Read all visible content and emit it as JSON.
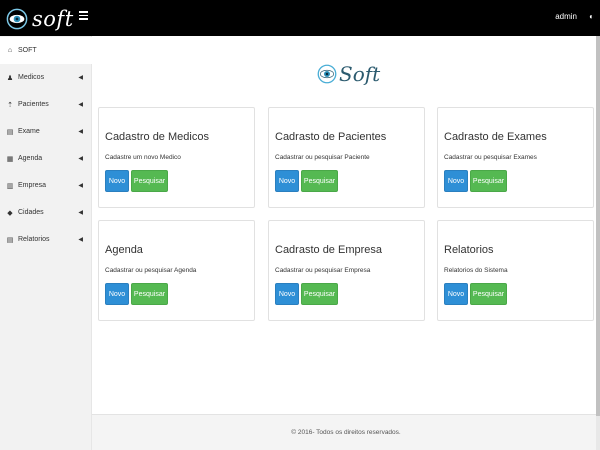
{
  "app": {
    "brand": "soft",
    "logo": "Soft"
  },
  "header": {
    "user": "admin",
    "user_icon": "power-icon"
  },
  "sidebar": {
    "items": [
      {
        "label": "SOFT",
        "icon": "home-icon",
        "glyph": "⌂",
        "caret": ""
      },
      {
        "label": "Medicos",
        "icon": "user-icon",
        "glyph": "♟",
        "caret": "◀"
      },
      {
        "label": "Pacientes",
        "icon": "upload-icon",
        "glyph": "⇡",
        "caret": "◀"
      },
      {
        "label": "Exame",
        "icon": "document-icon",
        "glyph": "▤",
        "caret": "◀"
      },
      {
        "label": "Agenda",
        "icon": "calendar-icon",
        "glyph": "▦",
        "caret": "◀"
      },
      {
        "label": "Empresa",
        "icon": "bank-icon",
        "glyph": "▥",
        "caret": "◀"
      },
      {
        "label": "Cidades",
        "icon": "tag-icon",
        "glyph": "◆",
        "caret": "◀"
      },
      {
        "label": "Relatorios",
        "icon": "file-icon",
        "glyph": "▤",
        "caret": "◀"
      }
    ]
  },
  "cards": [
    {
      "title": "Cadastro de Medicos",
      "desc": "Cadastre um novo Medico",
      "btn_new": "Novo",
      "btn_search": "Pesquisar"
    },
    {
      "title": "Cadrasto de Pacientes",
      "desc": "Cadastrar ou pesquisar Paciente",
      "btn_new": "Novo",
      "btn_search": "Pesquisar"
    },
    {
      "title": "Cadrasto de Exames",
      "desc": "Cadastrar ou pesquisar Exames",
      "btn_new": "Novo",
      "btn_search": "Pesquisar"
    },
    {
      "title": "Agenda",
      "desc": "Cadastrar ou pesquisar Agenda",
      "btn_new": "Novo",
      "btn_search": "Pesquisar"
    },
    {
      "title": "Cadrasto de Empresa",
      "desc": "Cadastrar ou pesquisar Empresa",
      "btn_new": "Novo",
      "btn_search": "Pesquisar"
    },
    {
      "title": "Relatorios",
      "desc": "Relatorios do Sistema",
      "btn_new": "Novo",
      "btn_search": "Pesquisar"
    }
  ],
  "footer": {
    "text": "© 2016- Todos os direitos reservados."
  },
  "colors": {
    "primary": "#2e8fd6",
    "success": "#55b952",
    "topbar": "#000000",
    "brand": "#2b5a6e"
  }
}
